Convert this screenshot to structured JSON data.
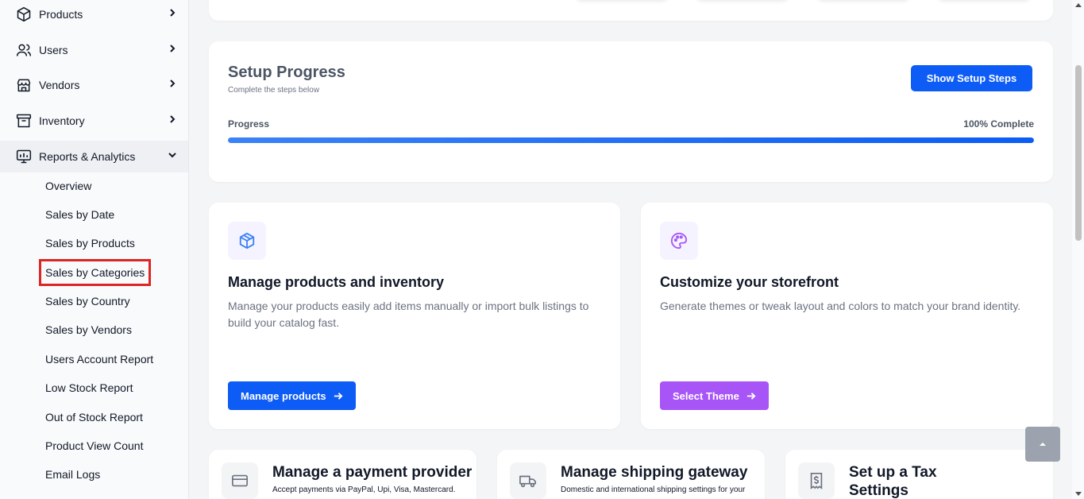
{
  "sidebar": {
    "items": [
      {
        "label": "Products",
        "icon": "box-icon"
      },
      {
        "label": "Users",
        "icon": "users-icon"
      },
      {
        "label": "Vendors",
        "icon": "store-icon"
      },
      {
        "label": "Inventory",
        "icon": "archive-icon"
      },
      {
        "label": "Reports & Analytics",
        "icon": "monitor-chart-icon",
        "expanded": true
      }
    ],
    "sub_items": [
      "Overview",
      "Sales by Date",
      "Sales by Products",
      "Sales by Categories",
      "Sales by Country",
      "Sales by Vendors",
      "Users Account Report",
      "Low Stock Report",
      "Out of Stock Report",
      "Product View Count",
      "Email Logs"
    ],
    "selected_sub_item": "Sales by Categories"
  },
  "setup": {
    "title": "Setup Progress",
    "subtitle": "Complete the steps below",
    "button_label": "Show Setup Steps",
    "progress_label": "Progress",
    "progress_text": "100% Complete",
    "progress_value": 1.0
  },
  "features": [
    {
      "title": "Manage products and inventory",
      "description": "Manage your products easily add items manually or import bulk listings to build your catalog fast.",
      "button_label": "Manage products",
      "icon": "cube-icon",
      "accent": "#0d5cf5"
    },
    {
      "title": "Customize your storefront",
      "description": "Generate themes or tweak layout and colors to match your brand identity.",
      "button_label": "Select Theme",
      "icon": "palette-icon",
      "accent": "#a855f7"
    }
  ],
  "bottom_cards": [
    {
      "title": "Manage a payment provider",
      "description": "Accept payments via PayPal, Upi, Visa, Mastercard.",
      "icon": "credit-card-icon"
    },
    {
      "title": "Manage shipping gateway",
      "description": "Domestic and international shipping settings for your",
      "icon": "truck-icon"
    },
    {
      "title": "Set up a Tax Settings",
      "description": "",
      "icon": "receipt-dollar-icon"
    }
  ],
  "colors": {
    "primary": "#0d5cf5",
    "purple": "#a855f7",
    "highlight": "#dc2626"
  }
}
